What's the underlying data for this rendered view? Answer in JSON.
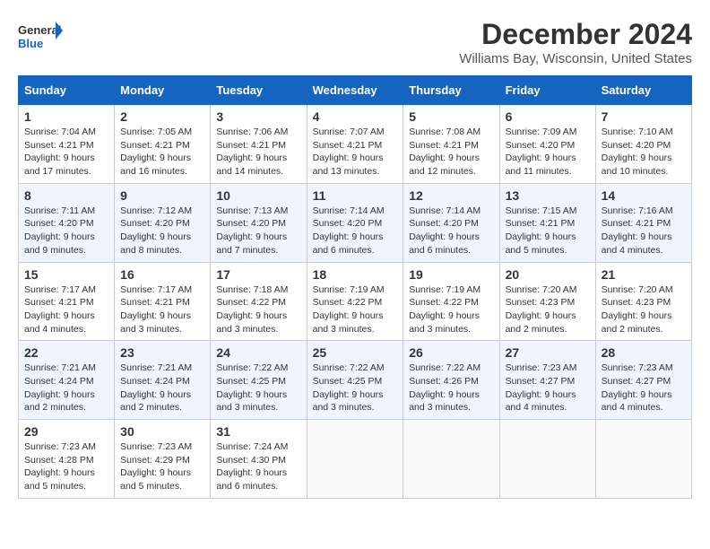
{
  "header": {
    "logo_line1": "General",
    "logo_line2": "Blue",
    "month_title": "December 2024",
    "location": "Williams Bay, Wisconsin, United States"
  },
  "weekdays": [
    "Sunday",
    "Monday",
    "Tuesday",
    "Wednesday",
    "Thursday",
    "Friday",
    "Saturday"
  ],
  "weeks": [
    [
      {
        "day": "1",
        "sunrise": "7:04 AM",
        "sunset": "4:21 PM",
        "daylight": "9 hours and 17 minutes."
      },
      {
        "day": "2",
        "sunrise": "7:05 AM",
        "sunset": "4:21 PM",
        "daylight": "9 hours and 16 minutes."
      },
      {
        "day": "3",
        "sunrise": "7:06 AM",
        "sunset": "4:21 PM",
        "daylight": "9 hours and 14 minutes."
      },
      {
        "day": "4",
        "sunrise": "7:07 AM",
        "sunset": "4:21 PM",
        "daylight": "9 hours and 13 minutes."
      },
      {
        "day": "5",
        "sunrise": "7:08 AM",
        "sunset": "4:21 PM",
        "daylight": "9 hours and 12 minutes."
      },
      {
        "day": "6",
        "sunrise": "7:09 AM",
        "sunset": "4:20 PM",
        "daylight": "9 hours and 11 minutes."
      },
      {
        "day": "7",
        "sunrise": "7:10 AM",
        "sunset": "4:20 PM",
        "daylight": "9 hours and 10 minutes."
      }
    ],
    [
      {
        "day": "8",
        "sunrise": "7:11 AM",
        "sunset": "4:20 PM",
        "daylight": "9 hours and 9 minutes."
      },
      {
        "day": "9",
        "sunrise": "7:12 AM",
        "sunset": "4:20 PM",
        "daylight": "9 hours and 8 minutes."
      },
      {
        "day": "10",
        "sunrise": "7:13 AM",
        "sunset": "4:20 PM",
        "daylight": "9 hours and 7 minutes."
      },
      {
        "day": "11",
        "sunrise": "7:14 AM",
        "sunset": "4:20 PM",
        "daylight": "9 hours and 6 minutes."
      },
      {
        "day": "12",
        "sunrise": "7:14 AM",
        "sunset": "4:20 PM",
        "daylight": "9 hours and 6 minutes."
      },
      {
        "day": "13",
        "sunrise": "7:15 AM",
        "sunset": "4:21 PM",
        "daylight": "9 hours and 5 minutes."
      },
      {
        "day": "14",
        "sunrise": "7:16 AM",
        "sunset": "4:21 PM",
        "daylight": "9 hours and 4 minutes."
      }
    ],
    [
      {
        "day": "15",
        "sunrise": "7:17 AM",
        "sunset": "4:21 PM",
        "daylight": "9 hours and 4 minutes."
      },
      {
        "day": "16",
        "sunrise": "7:17 AM",
        "sunset": "4:21 PM",
        "daylight": "9 hours and 3 minutes."
      },
      {
        "day": "17",
        "sunrise": "7:18 AM",
        "sunset": "4:22 PM",
        "daylight": "9 hours and 3 minutes."
      },
      {
        "day": "18",
        "sunrise": "7:19 AM",
        "sunset": "4:22 PM",
        "daylight": "9 hours and 3 minutes."
      },
      {
        "day": "19",
        "sunrise": "7:19 AM",
        "sunset": "4:22 PM",
        "daylight": "9 hours and 3 minutes."
      },
      {
        "day": "20",
        "sunrise": "7:20 AM",
        "sunset": "4:23 PM",
        "daylight": "9 hours and 2 minutes."
      },
      {
        "day": "21",
        "sunrise": "7:20 AM",
        "sunset": "4:23 PM",
        "daylight": "9 hours and 2 minutes."
      }
    ],
    [
      {
        "day": "22",
        "sunrise": "7:21 AM",
        "sunset": "4:24 PM",
        "daylight": "9 hours and 2 minutes."
      },
      {
        "day": "23",
        "sunrise": "7:21 AM",
        "sunset": "4:24 PM",
        "daylight": "9 hours and 2 minutes."
      },
      {
        "day": "24",
        "sunrise": "7:22 AM",
        "sunset": "4:25 PM",
        "daylight": "9 hours and 3 minutes."
      },
      {
        "day": "25",
        "sunrise": "7:22 AM",
        "sunset": "4:25 PM",
        "daylight": "9 hours and 3 minutes."
      },
      {
        "day": "26",
        "sunrise": "7:22 AM",
        "sunset": "4:26 PM",
        "daylight": "9 hours and 3 minutes."
      },
      {
        "day": "27",
        "sunrise": "7:23 AM",
        "sunset": "4:27 PM",
        "daylight": "9 hours and 4 minutes."
      },
      {
        "day": "28",
        "sunrise": "7:23 AM",
        "sunset": "4:27 PM",
        "daylight": "9 hours and 4 minutes."
      }
    ],
    [
      {
        "day": "29",
        "sunrise": "7:23 AM",
        "sunset": "4:28 PM",
        "daylight": "9 hours and 5 minutes."
      },
      {
        "day": "30",
        "sunrise": "7:23 AM",
        "sunset": "4:29 PM",
        "daylight": "9 hours and 5 minutes."
      },
      {
        "day": "31",
        "sunrise": "7:24 AM",
        "sunset": "4:30 PM",
        "daylight": "9 hours and 6 minutes."
      },
      null,
      null,
      null,
      null
    ]
  ],
  "labels": {
    "sunrise": "Sunrise:",
    "sunset": "Sunset:",
    "daylight": "Daylight:"
  }
}
